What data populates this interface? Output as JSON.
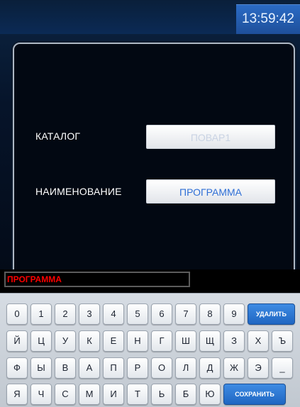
{
  "header": {
    "time": "13:59:42"
  },
  "form": {
    "catalog_label": "КАТАЛОГ",
    "catalog_value": "ПОВАР1",
    "name_label": "НАИМЕНОВАНИЕ",
    "name_value": "ПРОГРАММА"
  },
  "input": {
    "value": "ПРОГРАММА",
    "text_color": "#ff0000"
  },
  "keyboard": {
    "row1": [
      "0",
      "1",
      "2",
      "3",
      "4",
      "5",
      "6",
      "7",
      "8",
      "9"
    ],
    "row2": [
      "Й",
      "Ц",
      "У",
      "К",
      "Е",
      "Н",
      "Г",
      "Ш",
      "Щ",
      "З",
      "Х",
      "Ъ"
    ],
    "row3": [
      "Ф",
      "Ы",
      "В",
      "А",
      "П",
      "Р",
      "О",
      "Л",
      "Д",
      "Ж",
      "Э",
      "_"
    ],
    "row4": [
      "Я",
      "Ч",
      "С",
      "М",
      "И",
      "Т",
      "Ь",
      "Б",
      "Ю"
    ],
    "delete_label": "УДАЛИТЬ",
    "save_label": "СОХРАНИТЬ",
    "accent": "#2a72d0"
  }
}
